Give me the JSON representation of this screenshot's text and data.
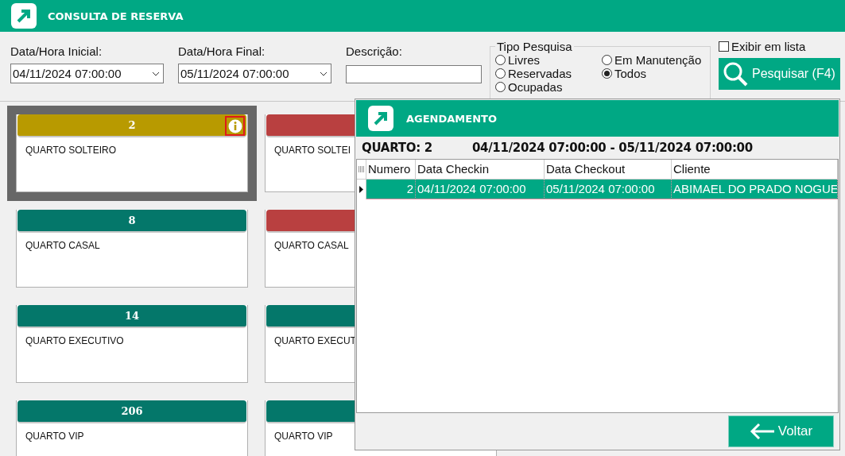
{
  "header": {
    "title": "CONSULTA DE RESERVA"
  },
  "filters": [
    {
      "label": "Data/Hora Inicial:",
      "value": "04/11/2024 07:00:00",
      "kind": "dropdown"
    },
    {
      "label": "Data/Hora Final:",
      "value": "05/11/2024 07:00:00",
      "kind": "dropdown"
    },
    {
      "label": "Descrição:",
      "kind": "text"
    }
  ],
  "search_type": {
    "title": "Tipo Pesquisa",
    "options": [
      {
        "label": "Livres",
        "selected": false
      },
      {
        "label": "Reservadas",
        "selected": false
      },
      {
        "label": "Ocupadas",
        "selected": false
      },
      {
        "label": "Em Manutenção",
        "selected": false
      },
      {
        "label": "Todos",
        "selected": true
      }
    ]
  },
  "list_view": {
    "label": "Exibir em lista",
    "checked": false
  },
  "search_button": {
    "label": "Pesquisar (F4)"
  },
  "rooms": [
    {
      "number": "2",
      "type": "QUARTO SOLTEIRO",
      "color": "#b89a00",
      "selected": true,
      "info": true
    },
    {
      "type": "QUARTO SOLTEI",
      "color": "#b94040",
      "selected": false
    },
    {
      "number": "8",
      "type": "QUARTO CASAL",
      "color": "#04776a",
      "selected": false
    },
    {
      "type": "QUARTO CASAL",
      "color": "#b94040",
      "selected": false
    },
    {
      "number": "14",
      "type": "QUARTO EXECUTIVO",
      "color": "#04776a",
      "selected": false
    },
    {
      "type": "QUARTO EXECUT",
      "color": "#04776a",
      "selected": false
    },
    {
      "number": "206",
      "type": "QUARTO VIP",
      "color": "#04776a",
      "selected": false
    },
    {
      "type": "QUARTO VIP",
      "color": "#04776a",
      "selected": false
    }
  ],
  "modal": {
    "title": "AGENDAMENTO",
    "room": "QUARTO: 2",
    "period": "04/11/2024 07:00:00 - 05/11/2024 07:00:00",
    "columns": [
      "Numero",
      "Data Checkin",
      "Data Checkout",
      "Cliente"
    ],
    "rows": [
      {
        "cells": [
          "2",
          "04/11/2024 07:00:00",
          "05/11/2024 07:00:00",
          "ABIMAEL DO PRADO NOGUE"
        ],
        "selected": true
      }
    ],
    "back_button": {
      "label": "Voltar"
    }
  }
}
